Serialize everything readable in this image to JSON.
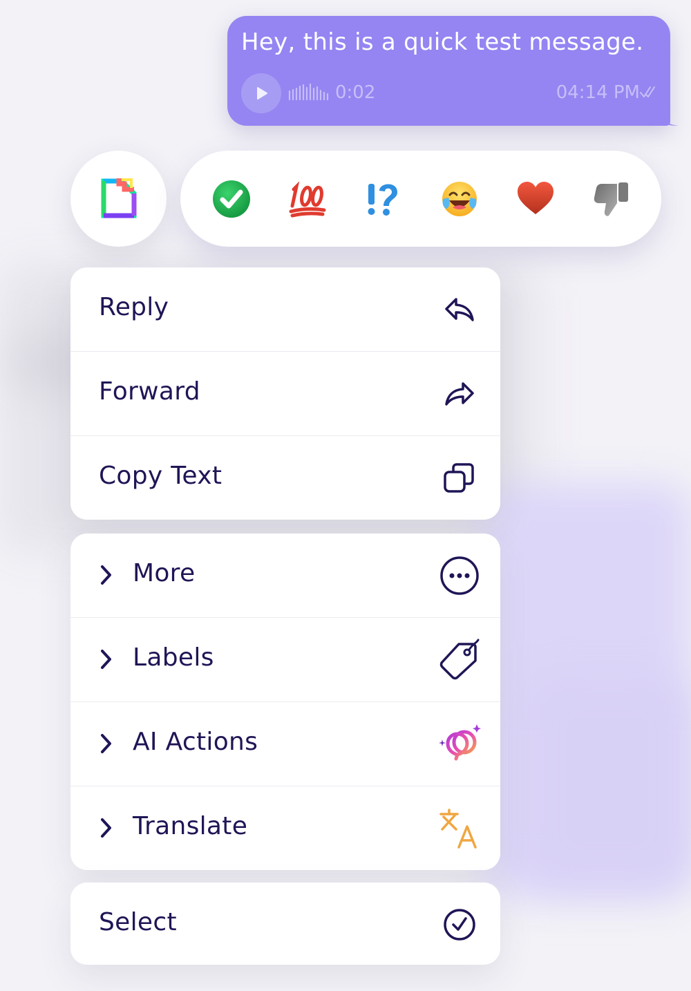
{
  "message": {
    "text": "Hey, this is a quick test message.",
    "duration": "0:02",
    "time": "04:14 PM",
    "bubble_color": "#9485f2"
  },
  "reactions": {
    "gif_icon": "gif-sticker-icon",
    "items": [
      {
        "name": "check-mark-icon",
        "glyph": "✅"
      },
      {
        "name": "hundred-points-icon",
        "glyph": "💯"
      },
      {
        "name": "interrobang-icon",
        "glyph": "⁉"
      },
      {
        "name": "tears-of-joy-icon",
        "glyph": "😂"
      },
      {
        "name": "heart-icon",
        "glyph": "❤"
      },
      {
        "name": "thumbs-down-icon",
        "glyph": "👎"
      }
    ]
  },
  "menu": {
    "group1": [
      {
        "label": "Reply",
        "icon": "reply-icon"
      },
      {
        "label": "Forward",
        "icon": "forward-icon"
      },
      {
        "label": "Copy Text",
        "icon": "copy-icon"
      }
    ],
    "group2": [
      {
        "label": "More",
        "icon": "more-icon"
      },
      {
        "label": "Labels",
        "icon": "tag-icon"
      },
      {
        "label": "AI Actions",
        "icon": "ai-sparkle-icon"
      },
      {
        "label": "Translate",
        "icon": "translate-icon"
      }
    ],
    "group3": [
      {
        "label": "Select",
        "icon": "select-check-icon"
      }
    ]
  },
  "colors": {
    "text": "#1e1656",
    "translate_accent": "#f0a640",
    "ai_gradient": [
      "#e64fb0",
      "#f7a14b"
    ]
  }
}
